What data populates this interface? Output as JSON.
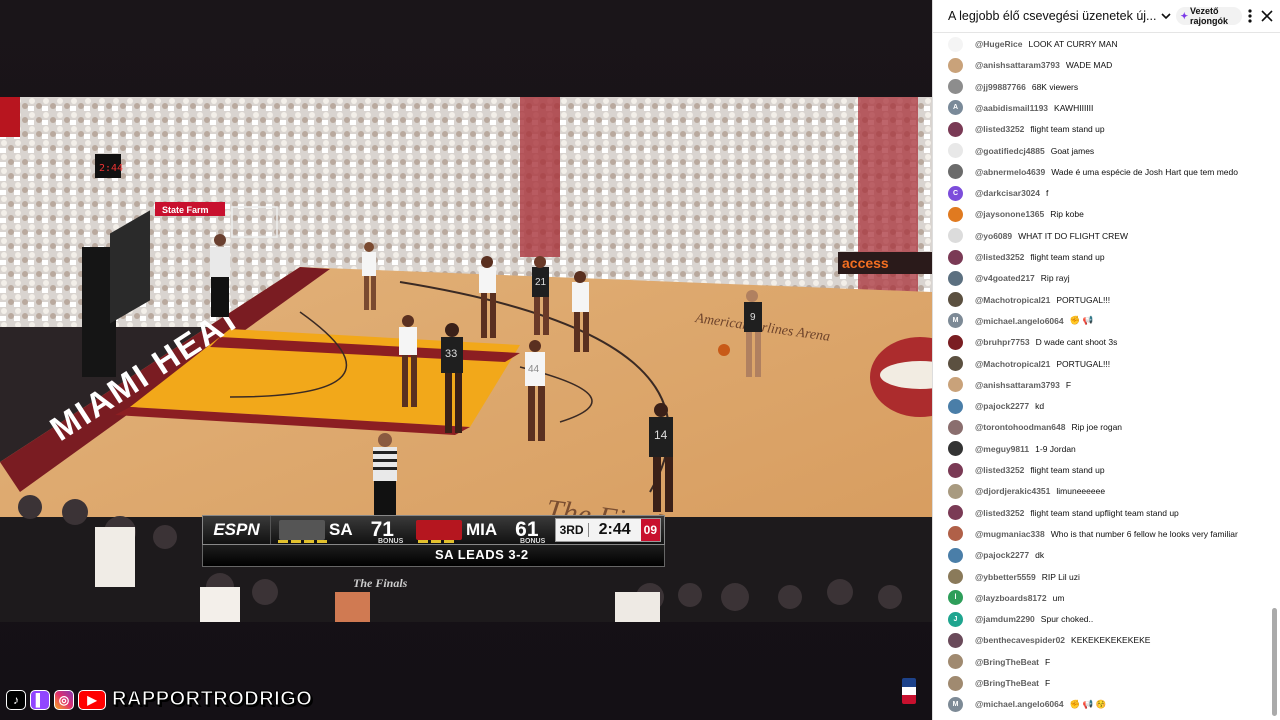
{
  "scoreboard": {
    "network": "ESPN",
    "away_abbr": "SA",
    "away_score": "71",
    "home_abbr": "MIA",
    "home_score": "61",
    "bonus_label": "BONUS",
    "quarter": "3RD",
    "clock": "2:44",
    "shot_clock": "09",
    "event": "The Finals",
    "series_status": "SA LEADS 3-2"
  },
  "court_text": {
    "baseline": "MIAMI HEAT",
    "arena": "AmericanAirlines Arena",
    "finals_logo": "The Finals",
    "sponsor": "State Farm",
    "jersey_33": "33",
    "jersey_21": "21",
    "jersey_14": "14",
    "jersey_9": "9"
  },
  "footer": {
    "handle": "RAPPORTRODRIGO"
  },
  "chat": {
    "title": "A legjobb élő csevegési üzenetek új...",
    "badge": "Vezető rajongók",
    "messages": [
      {
        "author": "@HugeRice",
        "text": "LOOK AT CURRY MAN",
        "color": "#f4f4f4",
        "letter": ""
      },
      {
        "author": "@anishsattaram3793",
        "text": "WADE MAD",
        "color": "#c9a27a",
        "letter": ""
      },
      {
        "author": "@jj99887766",
        "text": "68K viewers",
        "color": "#8d8d8d",
        "letter": ""
      },
      {
        "author": "@aabidismail1193",
        "text": "KAWHIIIIII",
        "color": "#7a8a99",
        "letter": "A"
      },
      {
        "author": "@listed3252",
        "text": "flight team stand up",
        "color": "#7a3a55",
        "letter": ""
      },
      {
        "author": "@goatifiedcj4885",
        "text": "Goat james",
        "color": "#e8e8e8",
        "letter": ""
      },
      {
        "author": "@abnermelo4639",
        "text": "Wade é uma espécie de Josh Hart que tem medo",
        "color": "#6b6b6b",
        "letter": ""
      },
      {
        "author": "@darkcisar3024",
        "text": "f",
        "color": "#7c4ddb",
        "letter": "C"
      },
      {
        "author": "@jaysonone1365",
        "text": "Rip kobe",
        "color": "#e07a20",
        "letter": ""
      },
      {
        "author": "@yo6089",
        "text": "WHAT IT DO FLIGHT CREW",
        "color": "#dcdcdc",
        "letter": ""
      },
      {
        "author": "@listed3252",
        "text": "flight team stand up",
        "color": "#7a3a55",
        "letter": ""
      },
      {
        "author": "@v4goated217",
        "text": "Rip rayj",
        "color": "#5c7080",
        "letter": ""
      },
      {
        "author": "@Machotropical21",
        "text": "PORTUGAL!!!",
        "color": "#5b5040",
        "letter": ""
      },
      {
        "author": "@michael.angelo6064",
        "text": "✊ 📢",
        "color": "#7d8a96",
        "letter": "M"
      },
      {
        "author": "@bruhpr7753",
        "text": "D wade cant shoot 3s",
        "color": "#7a1e22",
        "letter": ""
      },
      {
        "author": "@Machotropical21",
        "text": "PORTUGAL!!!",
        "color": "#5b5040",
        "letter": ""
      },
      {
        "author": "@anishsattaram3793",
        "text": "F",
        "color": "#c9a27a",
        "letter": ""
      },
      {
        "author": "@pajock2277",
        "text": "kd",
        "color": "#4a7ea8",
        "letter": ""
      },
      {
        "author": "@torontohoodman648",
        "text": "Rip joe rogan",
        "color": "#8a6e6e",
        "letter": ""
      },
      {
        "author": "@meguy9811",
        "text": "1-9 Jordan",
        "color": "#333333",
        "letter": ""
      },
      {
        "author": "@listed3252",
        "text": "flight team stand up",
        "color": "#7a3a55",
        "letter": ""
      },
      {
        "author": "@djordjerakic4351",
        "text": "limuneeeeee",
        "color": "#a89a80",
        "letter": ""
      },
      {
        "author": "@listed3252",
        "text": "flight team stand upflight team stand up",
        "color": "#7a3a55",
        "letter": ""
      },
      {
        "author": "@mugmaniac338",
        "text": "Who is that number 6 fellow he looks very familiar",
        "color": "#b06048",
        "letter": ""
      },
      {
        "author": "@pajock2277",
        "text": "dk",
        "color": "#4a7ea8",
        "letter": ""
      },
      {
        "author": "@ybbetter5559",
        "text": "RIP Lil uzi",
        "color": "#8a7a5a",
        "letter": ""
      },
      {
        "author": "@layzboards8172",
        "text": "um",
        "color": "#2e9e5a",
        "letter": "l"
      },
      {
        "author": "@jamdum2290",
        "text": "Spur choked..",
        "color": "#1fa58f",
        "letter": "J"
      },
      {
        "author": "@benthecavespider02",
        "text": "KEKEKEKEKEKEKE",
        "color": "#6a4a5a",
        "letter": ""
      },
      {
        "author": "@BringTheBeat",
        "text": "F",
        "color": "#a08a70",
        "letter": ""
      },
      {
        "author": "@BringTheBeat",
        "text": "F",
        "color": "#a08a70",
        "letter": ""
      },
      {
        "author": "@michael.angelo6064",
        "text": "✊ 📢 😚",
        "color": "#7d8a96",
        "letter": "M"
      }
    ]
  }
}
